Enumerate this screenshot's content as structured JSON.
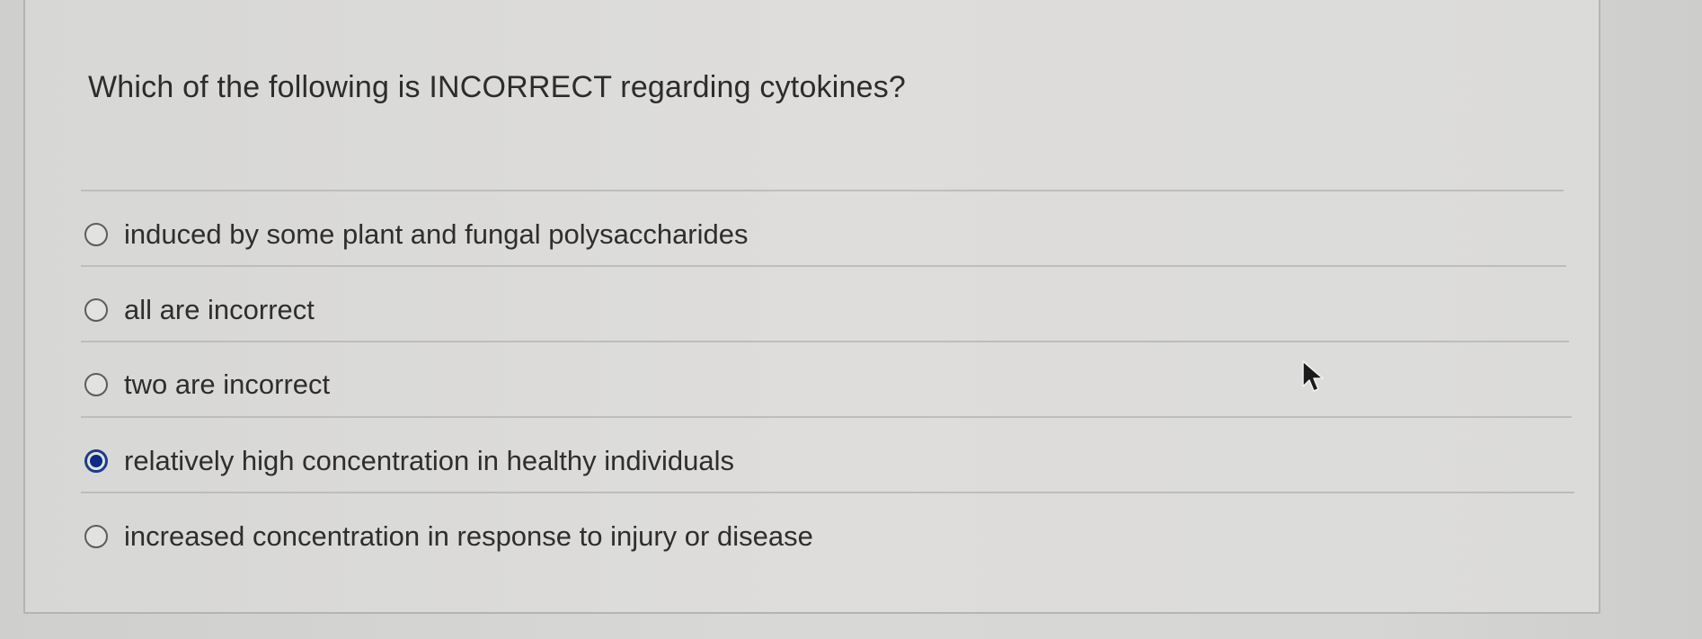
{
  "question": {
    "text": "Which of the following is INCORRECT regarding cytokines?"
  },
  "options": [
    {
      "label": "induced by some plant and fungal polysaccharides",
      "selected": false
    },
    {
      "label": "all are incorrect",
      "selected": false
    },
    {
      "label": "two are incorrect",
      "selected": false
    },
    {
      "label": "relatively high concentration in healthy individuals",
      "selected": true
    },
    {
      "label": "increased concentration in response to injury or disease",
      "selected": false
    }
  ],
  "colors": {
    "selected_accent": "#0d2b84",
    "text": "#2e2e2e",
    "background": "#d7d7d5"
  },
  "icons": {
    "pointer": "mouse-pointer-icon"
  }
}
